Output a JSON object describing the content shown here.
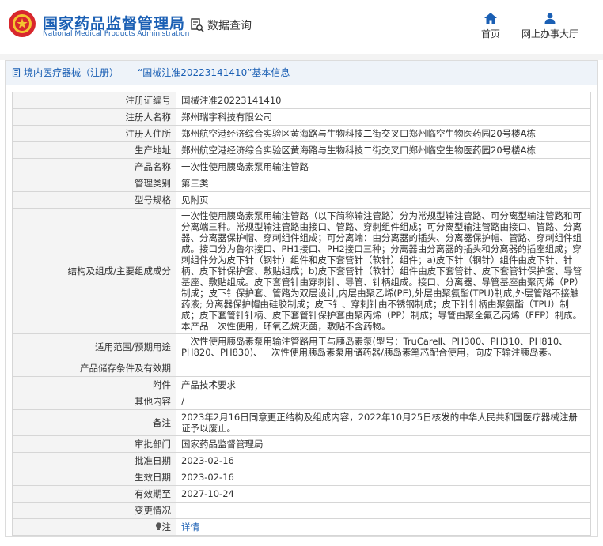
{
  "header": {
    "logo_cn": "国家药品监督管理局",
    "logo_en": "National Medical Products Administration",
    "search_label": "数据查询",
    "nav": [
      {
        "label": "首页",
        "icon": "home-icon"
      },
      {
        "label": "网上办事大厅",
        "icon": "user-icon"
      }
    ]
  },
  "breadcrumb": "境内医疗器械（注册）——“国械注准20223141410”基本信息",
  "rows": [
    {
      "label": "注册证编号",
      "value": "国械注准20223141410"
    },
    {
      "label": "注册人名称",
      "value": "郑州瑞宇科技有限公司"
    },
    {
      "label": "注册人住所",
      "value": "郑州航空港经济综合实验区黄海路与生物科技二街交叉口郑州临空生物医药园20号楼A栋"
    },
    {
      "label": "生产地址",
      "value": "郑州航空港经济综合实验区黄海路与生物科技二街交叉口郑州临空生物医药园20号楼A栋"
    },
    {
      "label": "产品名称",
      "value": "一次性使用胰岛素泵用输注管路"
    },
    {
      "label": "管理类别",
      "value": "第三类"
    },
    {
      "label": "型号规格",
      "value": "见附页"
    },
    {
      "label": "结构及组成/主要组成成分",
      "value": "一次性使用胰岛素泵用输注管路（以下简称输注管路）分为常规型输注管路、可分离型输注管路和可分离端三种。常规型输注管路由接口、管路、穿刺组件组成；可分离型输注管路由接口、管路、分离器、分离器保护帽、穿刺组件组成；可分离端：由分离器的插头、分离器保护帽、管路、穿刺组件组成。接口分为鲁尔接口、PH1接口、PH2接口三种；分离器由分离器的插头和分离器的插座组成；穿刺组件分为皮下针（钢针）组件和皮下套管针（软针）组件；a)皮下针（钢针）组件由皮下针、针柄、皮下针保护套、敷贴组成；b)皮下套管针（软针）组件由皮下套管针、皮下套管针保护套、导管基座、敷贴组成。皮下套管针由穿刺针、导管、针柄组成。接口、分离器、导管基座由聚丙烯（PP）制成；皮下针保护套、管路为双层设计,内层由聚乙烯(PE),外层由聚氨酯(TPU)制成,外层管路不接触药液; 分离器保护帽由硅胶制成；皮下针、穿刺针由不锈钢制成；皮下针针柄由聚氨酯（TPU）制成；皮下套管针针柄、皮下套管针保护套由聚丙烯（PP）制成；导管由聚全氟乙丙烯（FEP）制成。本产品一次性使用，环氧乙烷灭菌，敷贴不含药物。"
    },
    {
      "label": "适用范围/预期用途",
      "value": "一次性使用胰岛素泵用输注管路用于与胰岛素泵(型号：TruCareⅡ、PH300、PH310、PH810、PH820、PH830)、一次性使用胰岛素泵用储药器/胰岛素笔芯配合使用，向皮下输注胰岛素。"
    },
    {
      "label": "产品储存条件及有效期",
      "value": ""
    },
    {
      "label": "附件",
      "value": "产品技术要求"
    },
    {
      "label": "其他内容",
      "value": "/"
    },
    {
      "label": "备注",
      "value": "2023年2月16日同意更正结构及组成内容，2022年10月25日核发的中华人民共和国医疗器械注册证予以废止。"
    },
    {
      "label": "审批部门",
      "value": "国家药品监督管理局"
    },
    {
      "label": "批准日期",
      "value": "2023-02-16"
    },
    {
      "label": "生效日期",
      "value": "2023-02-16"
    },
    {
      "label": "有效期至",
      "value": "2027-10-24"
    },
    {
      "label": "变更情况",
      "value": ""
    },
    {
      "label": "注",
      "value": "详情",
      "icon": "bulb-icon"
    }
  ],
  "colors": {
    "brand": "#1a5fb4",
    "label_bg": "#f4f4f4",
    "border": "#d6d6d6"
  }
}
